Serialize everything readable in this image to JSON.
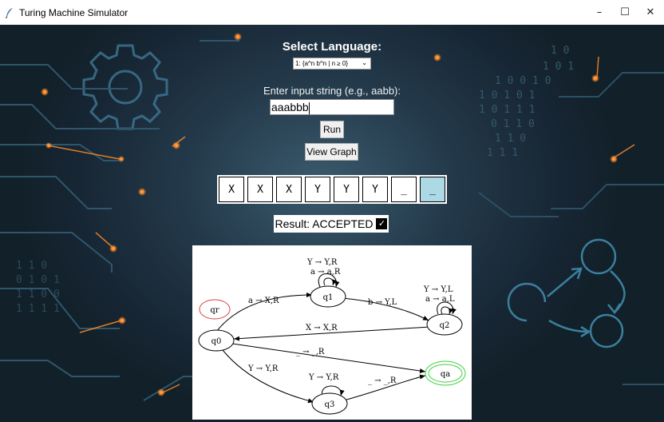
{
  "window": {
    "title": "Turing Machine Simulator",
    "controls": {
      "minimize": "–",
      "maximize": "☐",
      "close": "✕"
    }
  },
  "language": {
    "heading": "Select Language:",
    "selected": "1: {a^n b^n | n ≥ 0}"
  },
  "input": {
    "prompt": "Enter input string (e.g., aabb):",
    "value": "aaabbb"
  },
  "buttons": {
    "run": "Run",
    "view_graph": "View Graph"
  },
  "tape": {
    "cells": [
      "X",
      "X",
      "X",
      "Y",
      "Y",
      "Y",
      "_",
      "_"
    ],
    "head_index": 7
  },
  "result": {
    "text": "Result: ACCEPTED",
    "check": "✓"
  },
  "graph": {
    "states": {
      "q0": "q0",
      "q1": "q1",
      "q2": "q2",
      "q3": "q3",
      "qa": "qa",
      "qr": "qr"
    },
    "transitions": {
      "q0_q1": "a → X,R",
      "q1_loop_1": "Y → Y,R",
      "q1_loop_2": "a → a,R",
      "q1_q2": "b → Y,L",
      "q2_loop_1": "Y → Y,L",
      "q2_loop_2": "a → a,L",
      "q2_q0": "X → X,R",
      "q0_qa": "_ → _,R",
      "q0_q3": "Y → Y,R",
      "q3_loop": "Y → Y,R",
      "q3_qa": "_ → _,R"
    }
  },
  "background": {
    "binary_rows": [
      "1 0",
      "1 0 1",
      "1 0 0 1 0",
      "1 0 1 0 1",
      "1 0 1 1 1",
      "0 1 1 0",
      "1 1 0",
      "1 1 1"
    ],
    "binary_rows_left": [
      "1 1 0",
      "0 1 0 1",
      "1 1 0 0",
      "1 1 1 1"
    ]
  },
  "colors": {
    "accept": "#3fd23f",
    "reject": "#e04040",
    "head_cell": "#add8e6",
    "glow": "#ff8c28"
  }
}
